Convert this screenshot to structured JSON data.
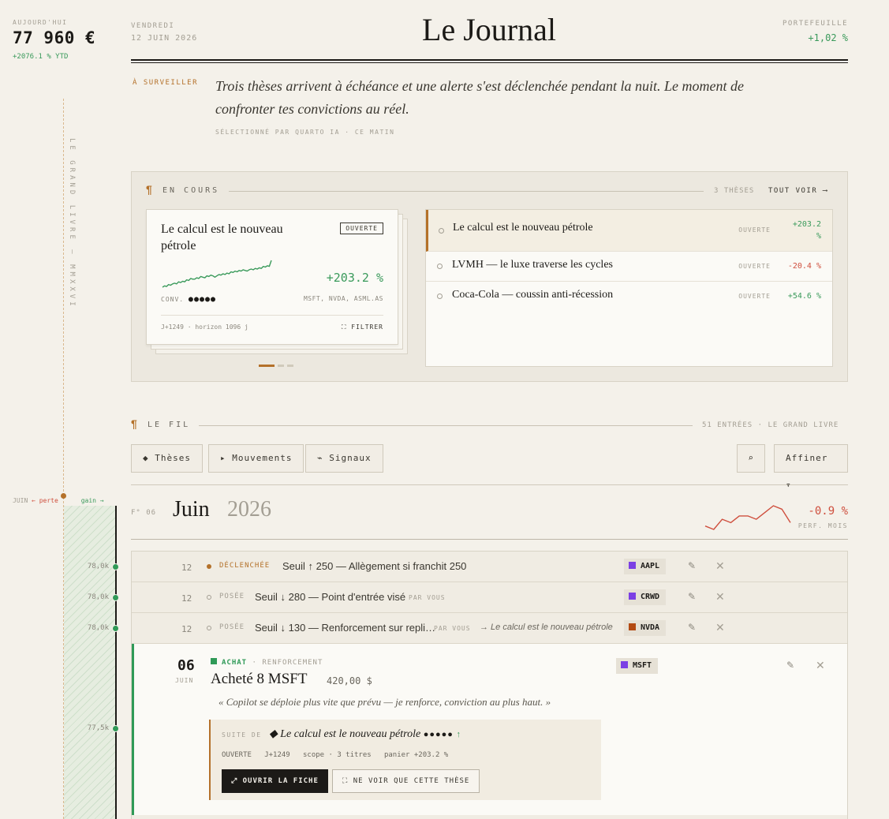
{
  "rail": {
    "today_label": "AUJOURD'HUI",
    "value": "77 960 €",
    "ytd": "+2076.1 % YTD",
    "vertical_title": "LE GRAND LIVRE — MMXXVI",
    "legend_month": "JUIN",
    "legend_loss": "← perte",
    "legend_gain": "gain →",
    "ticks": [
      "78,0k",
      "78,0k",
      "78,0k",
      "77,5k"
    ]
  },
  "header": {
    "weekday": "VENDREDI",
    "date": "12 JUIN 2026",
    "title": "Le Journal",
    "portfolio_label": "PORTEFEUILLE",
    "portfolio_change": "+1,02 %"
  },
  "watch": {
    "label": "À SURVEILLER",
    "text": "Trois thèses arrivent à échéance et une alerte s'est déclenchée pendant la nuit. Le moment de confronter tes convictions au réel.",
    "meta": "SÉLECTIONNÉ PAR QUARTO IA · CE MATIN"
  },
  "en_cours": {
    "pilcrow": "¶",
    "heading": "EN COURS",
    "count": "3 THÈSES",
    "see_all": "TOUT VOIR ⟶",
    "card": {
      "title": "Le calcul est le nouveau pétrole",
      "badge": "OUVERTE",
      "pct": "+203.2 %",
      "conv_label": "CONV.",
      "conv_dots": "●●●●●",
      "tickers": "MSFT, NVDA, ASML.AS",
      "foot": "J+1249 · horizon 1096 j",
      "filter": "⛶ FILTRER",
      "sparkline": [
        10,
        12,
        11,
        14,
        13,
        15,
        16,
        15,
        18,
        17,
        19,
        18,
        21,
        20,
        23,
        22,
        22,
        24,
        23,
        26,
        25,
        24,
        27,
        26,
        28,
        27,
        25,
        27,
        29,
        28,
        30,
        29,
        31,
        30,
        33,
        32,
        34,
        33,
        35,
        34,
        36,
        35,
        34,
        36,
        37,
        36,
        38,
        37,
        39,
        38,
        41,
        40,
        42,
        41,
        50
      ]
    },
    "items": [
      {
        "title": "Le calcul est le nouveau pétrole",
        "status": "OUVERTE",
        "pct": "+203.2 %",
        "sign": "pos"
      },
      {
        "title": "LVMH — le luxe traverse les cycles",
        "status": "OUVERTE",
        "pct": "-20.4 %",
        "sign": "neg"
      },
      {
        "title": "Coca-Cola — coussin anti-récession",
        "status": "OUVERTE",
        "pct": "+54.6 %",
        "sign": "pos"
      }
    ]
  },
  "fil": {
    "pilcrow": "¶",
    "heading": "LE FIL",
    "meta": "51 ENTRÉES · LE GRAND LIVRE",
    "filters": [
      "◆ Thèses",
      "▸ Mouvements",
      "⌁ Signaux"
    ],
    "search_icon": "⌕",
    "refine": "Affiner ▾"
  },
  "month": {
    "num": "F° 06",
    "name": "Juin",
    "year": "2026",
    "perf": "-0.9 %",
    "perf_label": "PERF. MOIS",
    "perf_series": [
      10,
      9,
      12,
      11,
      13,
      13,
      12,
      14,
      16,
      15,
      11
    ]
  },
  "entries": [
    {
      "day": "12",
      "status": "DÉCLENCHÉE",
      "text": "Seuil ↑ 250 — Allègement si franchit 250",
      "by": "",
      "link": "",
      "ticker": "AAPL",
      "ticker_color": "#7b3fe4",
      "dot": "#b4712a",
      "status_color": "#b4712a"
    },
    {
      "day": "12",
      "status": "POSÉE",
      "text": "Seuil ↓ 280 — Point d'entrée visé",
      "by": "PAR VOUS",
      "link": "",
      "ticker": "CRWD",
      "ticker_color": "#7b3fe4",
      "dot": "",
      "status_color": "#a39e93"
    },
    {
      "day": "12",
      "status": "POSÉE",
      "text": "Seuil ↓ 130 — Renforcement sur repli…",
      "by": "PAR VOUS",
      "link": "→ Le calcul est le nouveau pétrole",
      "ticker": "NVDA",
      "ticker_color": "#b34a12",
      "dot": "",
      "status_color": "#a39e93"
    }
  ],
  "expanded": {
    "day": "06",
    "month": "JUIN",
    "type": "ACHAT",
    "subtype": "· RENFORCEMENT",
    "title": "Acheté 8 MSFT",
    "price": "420,00 $",
    "ticker": "MSFT",
    "ticker_color": "#7b3fe4",
    "quote": "« Copilot se déploie plus vite que prévu — je renforce, conviction au plus haut. »",
    "suite_label": "SUITE DE",
    "thesis": "◆ Le calcul est le nouveau pétrole",
    "thesis_dots": "●●●●●",
    "thesis_arrow": "↑",
    "meta_status": "OUVERTE",
    "meta_day": "J+1249",
    "meta_scope": "scope · 3 titres",
    "meta_basket": "panier +203.2 %",
    "btn_open": "⤢ OUVRIR LA FICHE",
    "btn_only": "⛶ NE VOIR QUE CETTE THÈSE"
  },
  "icons": {
    "edit": "✎",
    "close": "✕"
  }
}
